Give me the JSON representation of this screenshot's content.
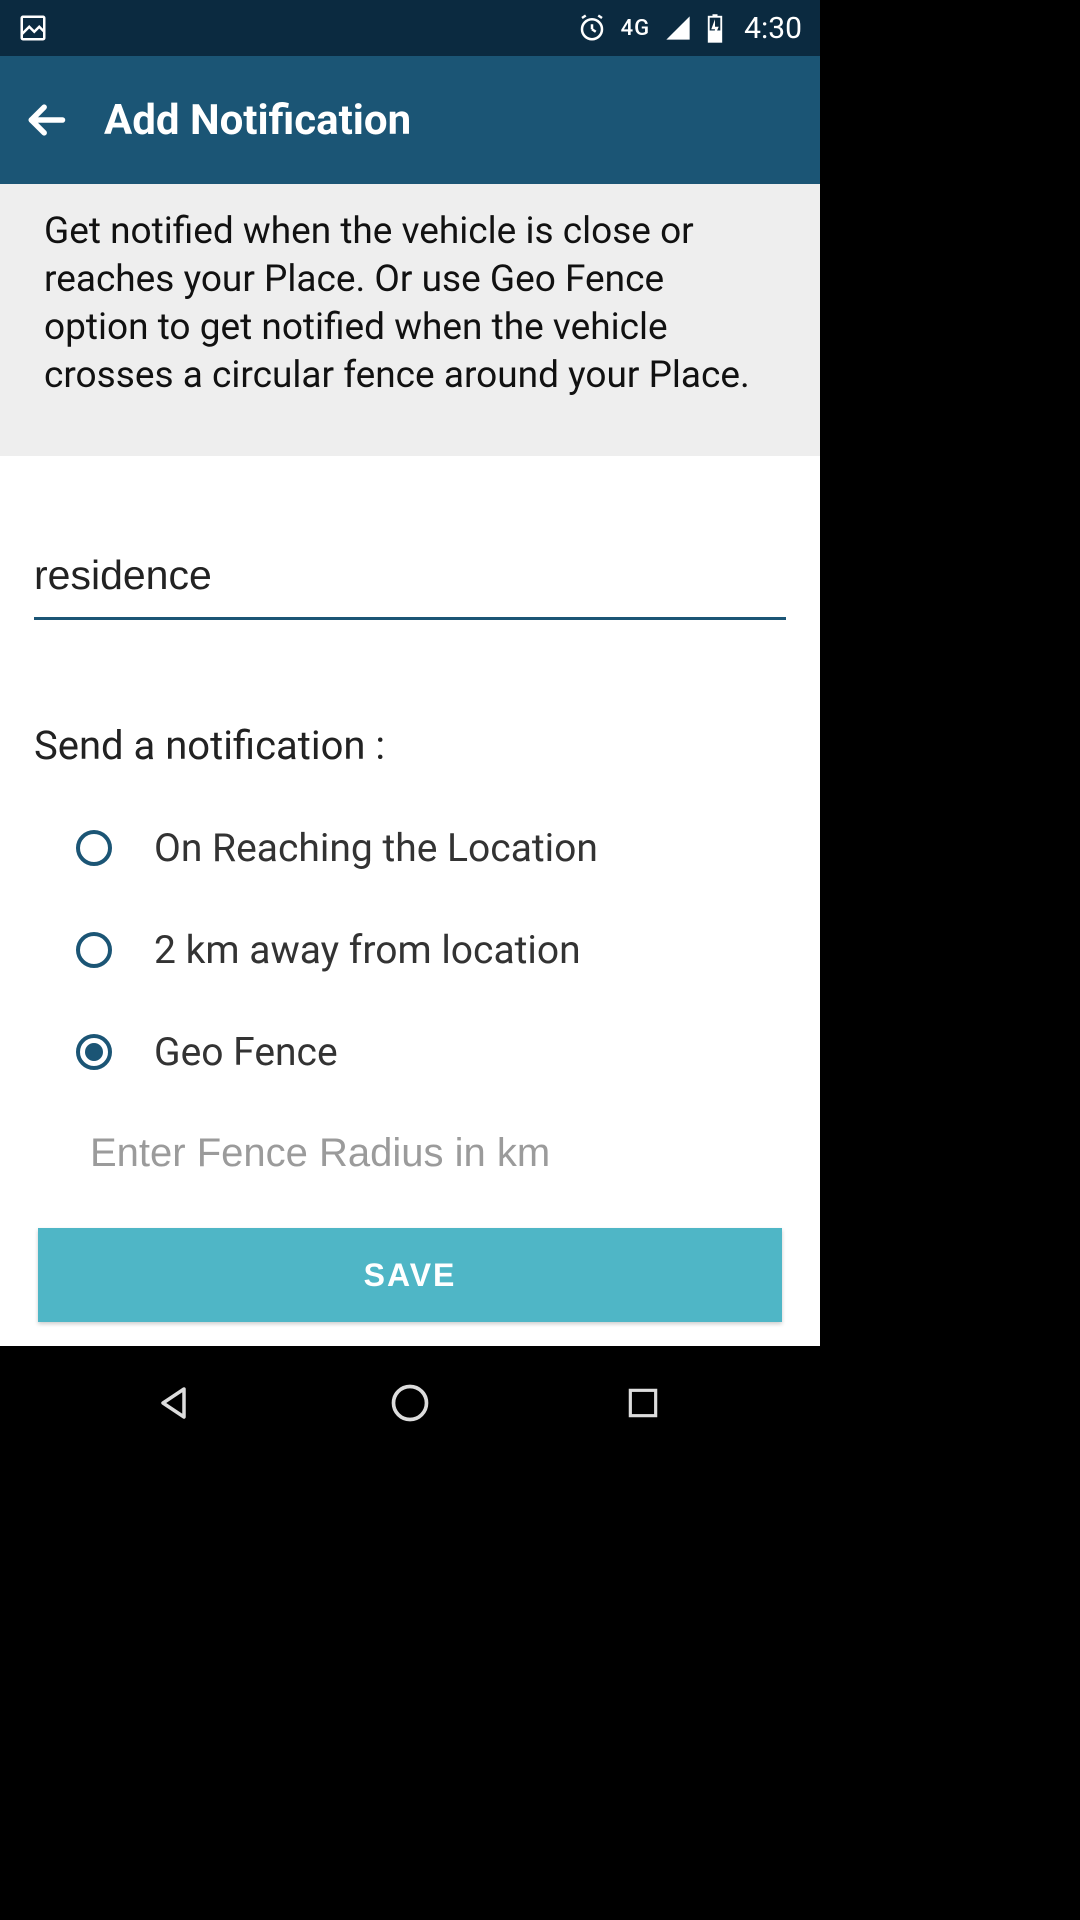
{
  "status": {
    "network_type": "4G",
    "time": "4:30"
  },
  "appbar": {
    "title": "Add Notification"
  },
  "description": "Get notified when the vehicle is close or reaches your Place. Or use Geo Fence option to get notified when the vehicle crosses a circular fence around your Place.",
  "form": {
    "place_value": "residence",
    "section_label": "Send a notification :",
    "options": [
      {
        "label": "On Reaching the Location",
        "selected": false
      },
      {
        "label": "2 km away from location",
        "selected": false
      },
      {
        "label": "Geo Fence",
        "selected": true
      }
    ],
    "radius_placeholder": "Enter Fence Radius in km",
    "radius_value": "",
    "save_label": "SAVE"
  }
}
